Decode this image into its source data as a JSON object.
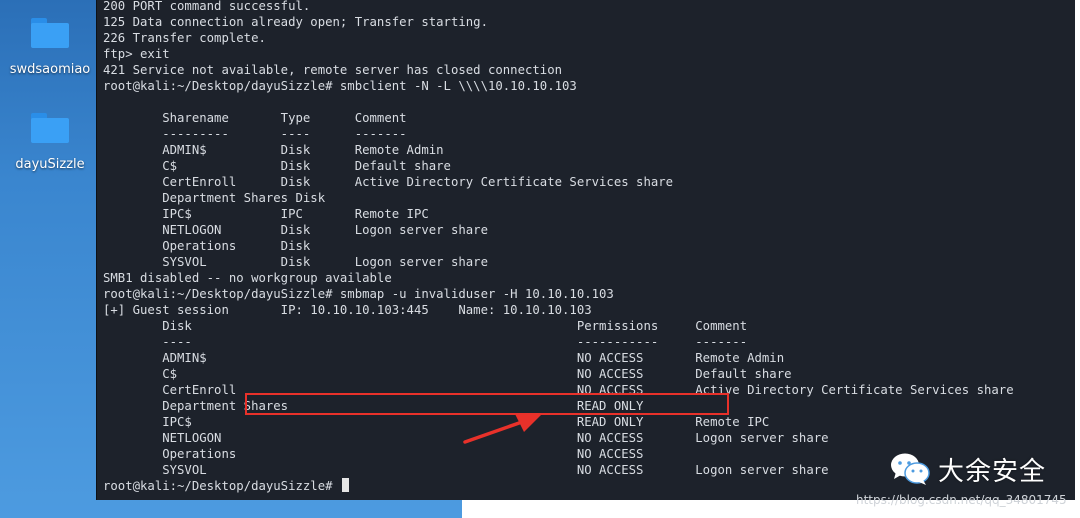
{
  "desktop": {
    "icons": [
      {
        "label": "swdsaomiao"
      },
      {
        "label": "dayuSizzle"
      }
    ]
  },
  "terminal": {
    "prompt_tail": "root@kali:~/Desktop/dayuSizzle# ",
    "lines": [
      "200 PORT command successful.",
      "125 Data connection already open; Transfer starting.",
      "226 Transfer complete.",
      "ftp> exit",
      "421 Service not available, remote server has closed connection",
      "root@kali:~/Desktop/dayuSizzle# smbclient -N -L \\\\\\\\10.10.10.103",
      "",
      "        Sharename       Type      Comment",
      "        ---------       ----      -------",
      "        ADMIN$          Disk      Remote Admin",
      "        C$              Disk      Default share",
      "        CertEnroll      Disk      Active Directory Certificate Services share",
      "        Department Shares Disk",
      "        IPC$            IPC       Remote IPC",
      "        NETLOGON        Disk      Logon server share",
      "        Operations      Disk",
      "        SYSVOL          Disk      Logon server share",
      "SMB1 disabled -- no workgroup available",
      "root@kali:~/Desktop/dayuSizzle# smbmap -u invaliduser -H 10.10.10.103",
      "[+] Guest session       IP: 10.10.10.103:445    Name: 10.10.10.103",
      "        Disk                                                    Permissions     Comment",
      "        ----                                                    -----------     -------",
      "        ADMIN$                                                  NO ACCESS       Remote Admin",
      "        C$                                                      NO ACCESS       Default share",
      "        CertEnroll                                              NO ACCESS       Active Directory Certificate Services share",
      "        Department Shares                                       READ ONLY",
      "        IPC$                                                    READ ONLY       Remote IPC",
      "        NETLOGON                                                NO ACCESS       Logon server share",
      "        Operations                                              NO ACCESS",
      "        SYSVOL                                                  NO ACCESS       Logon server share"
    ]
  },
  "annotation": {
    "color": "#e8312a"
  },
  "watermark": {
    "brand": "大余安全",
    "url": "https://blog.csdn.net/qq_34801745"
  }
}
